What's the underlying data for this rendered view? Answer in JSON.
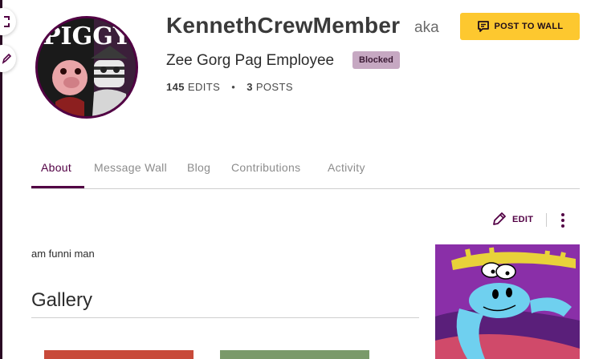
{
  "profile": {
    "username": "KennethCrewMember",
    "aka": "aka",
    "tagline": "Zee Gorg Pag Employee",
    "badge": "Blocked",
    "avatar_text": "PIGGY",
    "stats": {
      "edits_count": "145",
      "edits_label": "EDITS",
      "posts_count": "3",
      "posts_label": "POSTS",
      "separator": "•"
    }
  },
  "actions": {
    "post_to_wall": "POST TO WALL",
    "edit": "EDIT"
  },
  "tabs": [
    {
      "label": "About",
      "active": true
    },
    {
      "label": "Message Wall",
      "active": false
    },
    {
      "label": "Blog",
      "active": false
    },
    {
      "label": "Contributions",
      "active": false
    },
    {
      "label": "Activity",
      "active": false
    }
  ],
  "main": {
    "bio": "am funni man",
    "gallery_title": "Gallery"
  },
  "colors": {
    "accent": "#520044",
    "button": "#fdc82f",
    "badge_bg": "#c6a8c2"
  },
  "icons": {
    "post_button": "message-icon",
    "edit_button": "pencil-icon",
    "more": "more-vertical-icon"
  }
}
